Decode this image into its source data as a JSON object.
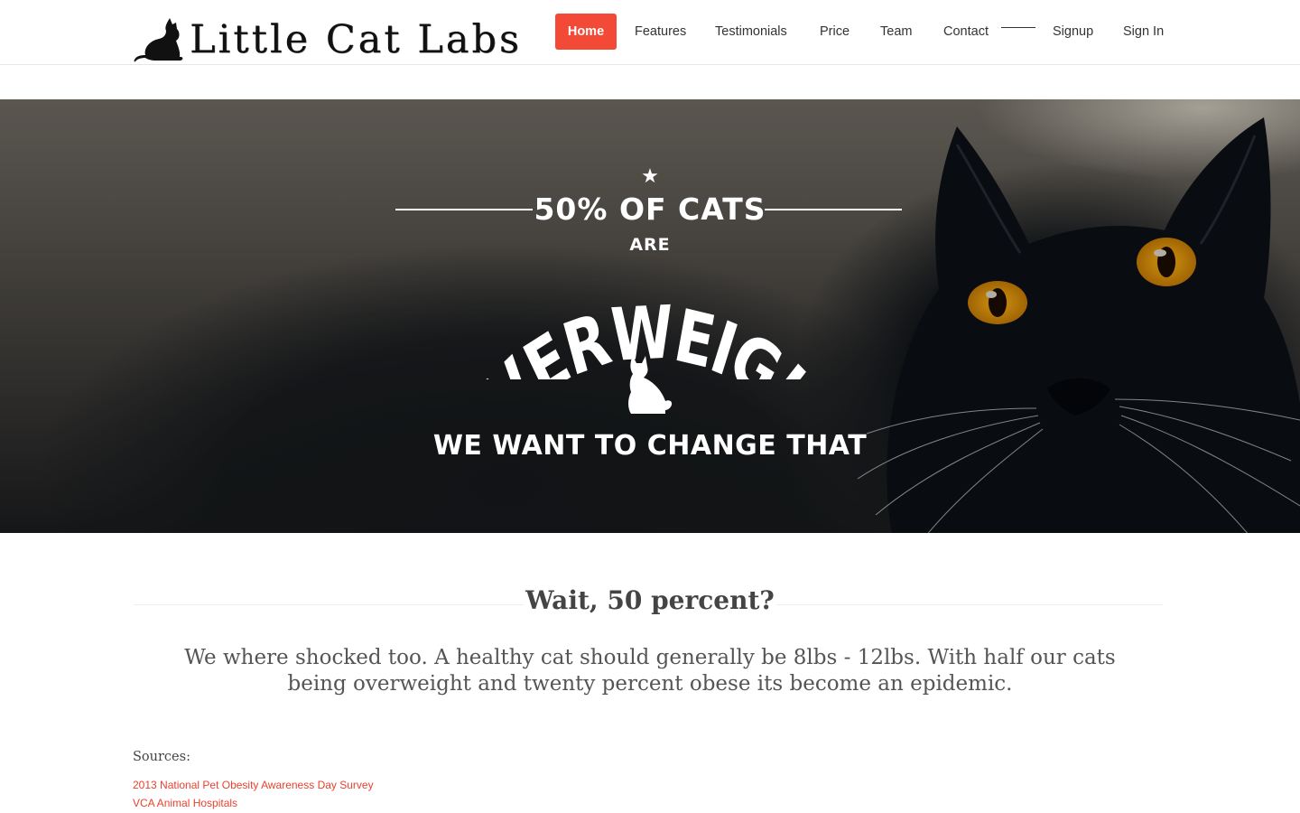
{
  "brand": {
    "name": "Little Cat Labs",
    "accent": "#f24a36"
  },
  "nav": {
    "items": [
      {
        "label": "Home",
        "active": true
      },
      {
        "label": "Features"
      },
      {
        "label": "Testimonials"
      },
      {
        "label": "Price"
      },
      {
        "label": "Team"
      },
      {
        "label": "Contact"
      },
      {
        "label": "Signup"
      },
      {
        "label": "Sign In"
      }
    ]
  },
  "hero": {
    "line1": "50% OF CATS",
    "line2": "ARE",
    "line3": "OVERWEIGHT",
    "line4": "WE WANT TO CHANGE THAT",
    "icons": [
      "star-icon",
      "cat-silhouette-icon"
    ]
  },
  "intro": {
    "title": "Wait, 50 percent?",
    "body": "We where shocked too. A healthy cat should generally be 8lbs - 12lbs. With half our cats being overweight and twenty percent obese its become an epidemic."
  },
  "sources": {
    "label": "Sources:",
    "links": [
      "2013 National Pet Obesity Awareness Day Survey",
      "VCA Animal Hospitals"
    ]
  }
}
